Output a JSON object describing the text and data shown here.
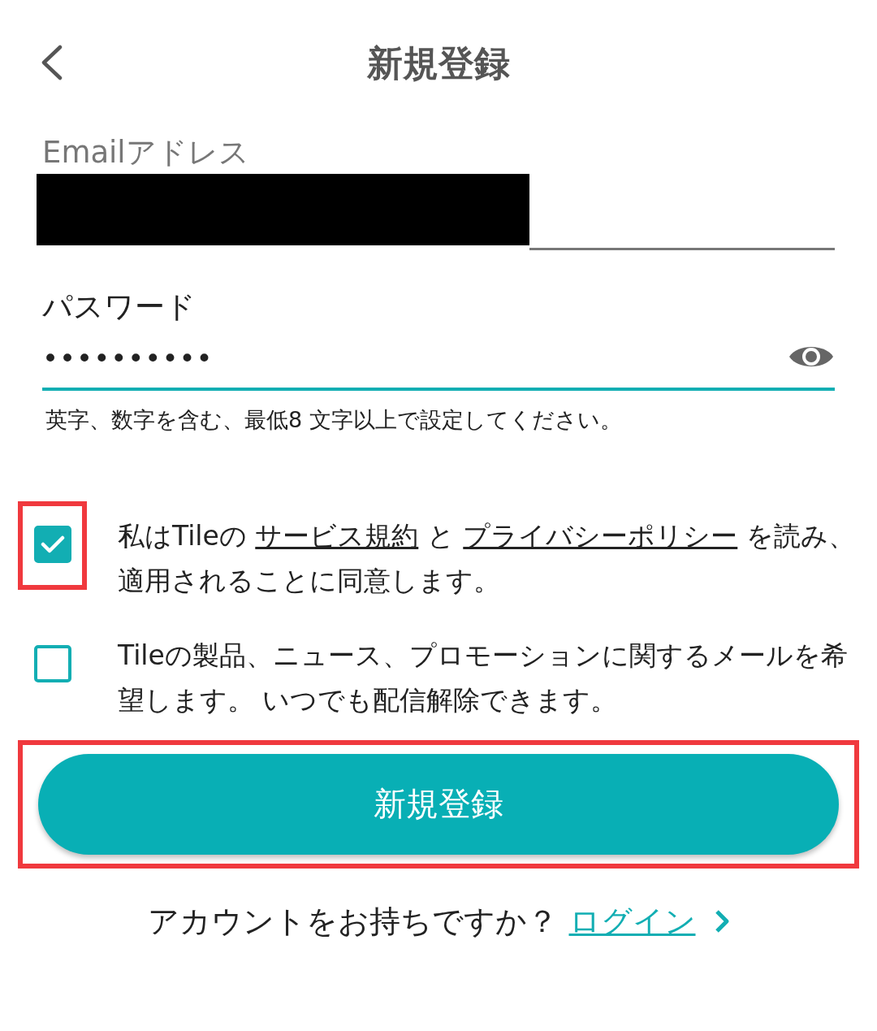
{
  "header": {
    "title": "新規登録"
  },
  "email": {
    "label": "Emailアドレス",
    "redacted": true,
    "focused": false
  },
  "password": {
    "label": "パスワード",
    "value": "••••••••••",
    "focused": true,
    "hint": "英字、数字を含む、最低8 文字以上で設定してください。"
  },
  "agreements": [
    {
      "checked": true,
      "highlighted": true,
      "segments": [
        {
          "kind": "text",
          "text": "私はTileの "
        },
        {
          "kind": "link",
          "text": "サービス規約"
        },
        {
          "kind": "text",
          "text": " と "
        },
        {
          "kind": "link",
          "text": "プライバシーポリシー"
        },
        {
          "kind": "text",
          "text": " を読み、適用されることに同意します。"
        }
      ]
    },
    {
      "checked": false,
      "highlighted": false,
      "segments": [
        {
          "kind": "text",
          "text": "Tileの製品、ニュース、プロモーションに関するメールを希望します。 いつでも配信解除できます。"
        }
      ]
    }
  ],
  "submit": {
    "label": "新規登録",
    "highlighted": true
  },
  "login": {
    "prompt": "アカウントをお持ちですか？",
    "link": "ログイン"
  }
}
